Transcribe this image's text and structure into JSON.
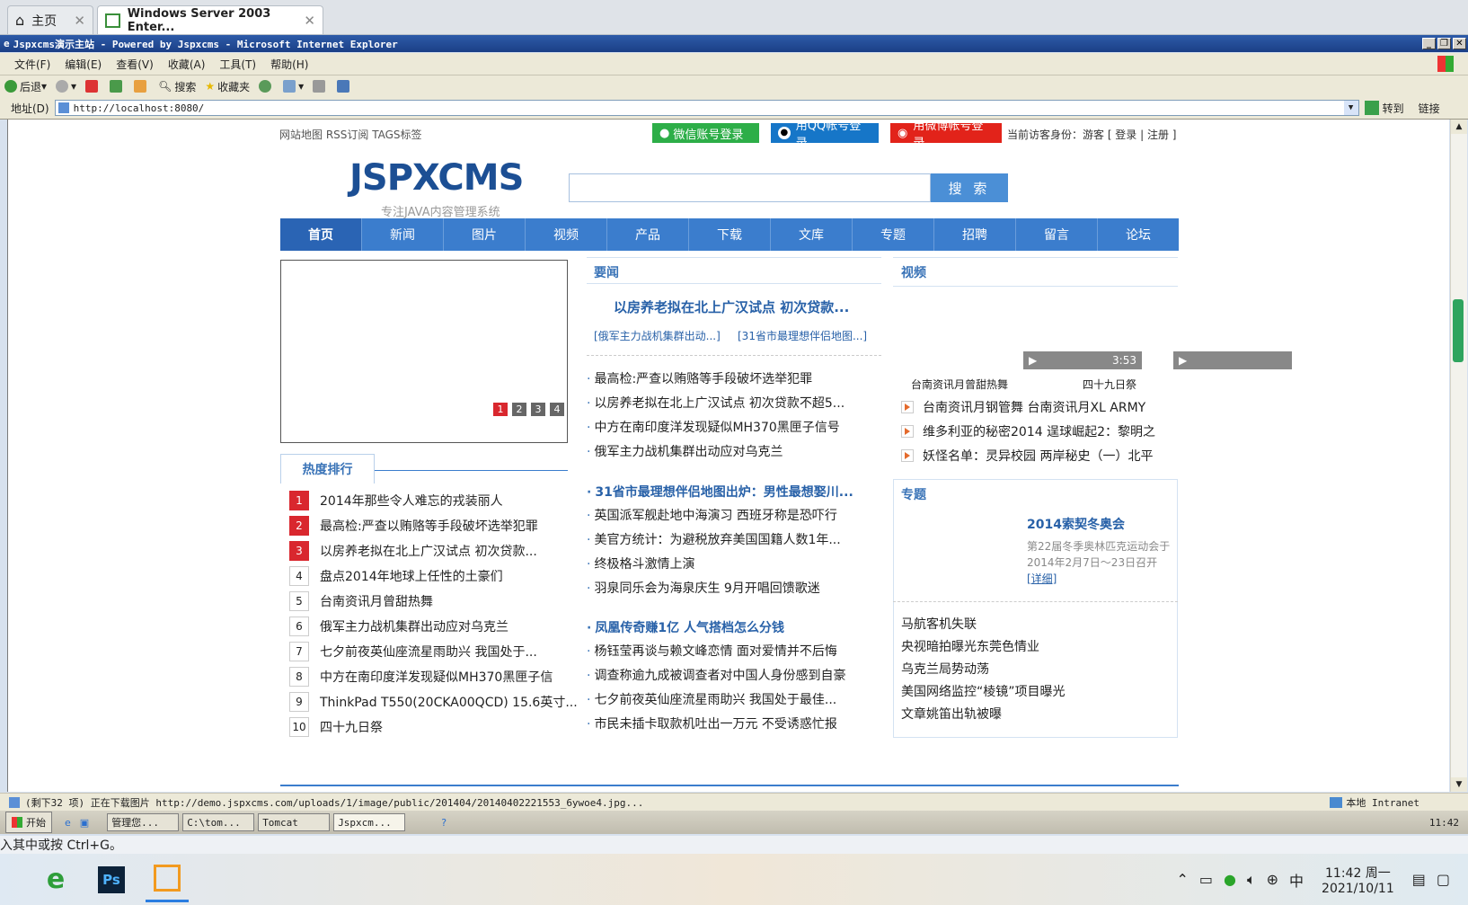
{
  "host_tabs": [
    {
      "label": "主页"
    },
    {
      "label": "Windows Server 2003 Enter..."
    }
  ],
  "ie": {
    "title": "Jspxcms演示主站 - Powered by Jspxcms - Microsoft Internet Explorer",
    "menu": [
      "文件(F)",
      "编辑(E)",
      "查看(V)",
      "收藏(A)",
      "工具(T)",
      "帮助(H)"
    ],
    "toolbar": {
      "back": "后退",
      "search": "搜索",
      "favorites": "收藏夹"
    },
    "address_label": "地址(D)",
    "address": "http://localhost:8080/",
    "go": "转到",
    "links": "链接"
  },
  "page": {
    "top_links": "网站地图 RSS订阅 TAGS标签",
    "login": {
      "wechat": "微信账号登录",
      "qq": "用QQ帐号登录",
      "weibo": "用微博帐号登录",
      "visitor": "当前访客身份：游客 [ 登录 | 注册 ]"
    },
    "logo": "JSPXCMS",
    "slogan": "专注JAVA内容管理系统",
    "search_button": "搜 索",
    "nav": [
      "首页",
      "新闻",
      "图片",
      "视频",
      "产品",
      "下载",
      "文库",
      "专题",
      "招聘",
      "留言",
      "论坛"
    ],
    "slider_dots": [
      "1",
      "2",
      "3",
      "4"
    ],
    "rank_title": "热度排行",
    "rank": [
      {
        "n": "1",
        "t": "2014年那些令人难忘的戎装丽人"
      },
      {
        "n": "2",
        "t": "最高检:严查以贿赂等手段破坏选举犯罪"
      },
      {
        "n": "3",
        "t": "以房养老拟在北上广汉试点 初次贷款..."
      },
      {
        "n": "4",
        "t": "盘点2014年地球上任性的土豪们"
      },
      {
        "n": "5",
        "t": "台南资讯月曾甜热舞"
      },
      {
        "n": "6",
        "t": "俄军主力战机集群出动应对乌克兰"
      },
      {
        "n": "7",
        "t": "七夕前夜英仙座流星雨助兴 我国处于..."
      },
      {
        "n": "8",
        "t": "中方在南印度洋发现疑似MH370黑匣子信"
      },
      {
        "n": "9",
        "t": "ThinkPad T550(20CKA00QCD) 15.6英寸..."
      },
      {
        "n": "10",
        "t": "四十九日祭"
      }
    ],
    "news_title": "要闻",
    "news_headline": "以房养老拟在北上广汉试点 初次贷款...",
    "news_sub": [
      "[俄军主力战机集群出动...]",
      "[31省市最理想伴侣地图...]"
    ],
    "news_list1": [
      "最高检:严查以贿赂等手段破坏选举犯罪",
      "以房养老拟在北上广汉试点 初次贷款不超5...",
      "中方在南印度洋发现疑似MH370黑匣子信号",
      "俄军主力战机集群出动应对乌克兰"
    ],
    "news_head2": "31省市最理想伴侣地图出炉：男性最想娶川...",
    "news_list2": [
      "英国派军舰赴地中海演习 西班牙称是恐吓行",
      "美官方统计：为避税放弃美国国籍人数1年...",
      "终极格斗激情上演",
      "羽泉同乐会为海泉庆生 9月开唱回馈歌迷"
    ],
    "news_head3": "凤凰传奇赚1亿 人气搭档怎么分钱",
    "news_list3": [
      "杨钰莹再谈与赖文峰恋情 面对爱情并不后悔",
      "调查称逾九成被调查者对中国人身份感到自豪",
      "七夕前夜英仙座流星雨助兴 我国处于最佳...",
      "市民未插卡取款机吐出一万元 不受诱惑忙报"
    ],
    "video_title": "视频",
    "video_duration": "3:53",
    "video_captions": [
      "台南资讯月曾甜热舞",
      "四十九日祭"
    ],
    "video_list": [
      "台南资讯月钢管舞  台南资讯月XL ARMY",
      "维多利亚的秘密2014  逞球崛起2：黎明之",
      "妖怪名单：灵异校园  两岸秘史（一）北平"
    ],
    "special_title": "专题",
    "special_head": "2014索契冬奥会",
    "special_desc": "第22届冬季奥林匹克运动会于2014年2月7日～23日召开",
    "special_more": "[详细]",
    "special_links": [
      "马航客机失联",
      "央视暗拍曝光东莞色情业",
      "乌克兰局势动荡",
      "美国网络监控“棱镜”项目曝光",
      "文章姚笛出轨被曝"
    ]
  },
  "status": {
    "text": "(剩下32 项) 正在下载图片 http://demo.jspxcms.com/uploads/1/image/public/201404/20140402221553_6ywoe4.jpg...",
    "zone": "本地 Intranet"
  },
  "xp_taskbar": {
    "start": "开始",
    "tasks": [
      "管理您...",
      "C:\\tom...",
      "Tomcat",
      "Jspxcm..."
    ],
    "clock": "11:42"
  },
  "hint": "入其中或按 Ctrl+G。",
  "win10": {
    "time": "11:42 周一",
    "date": "2021/10/11",
    "ime": "中"
  },
  "colors": {
    "accent": "#3b7dcd",
    "hot": "#d9272e",
    "link": "#2861a8",
    "wechat": "#2dae48",
    "qq": "#1676c8",
    "weibo": "#e2231a"
  }
}
